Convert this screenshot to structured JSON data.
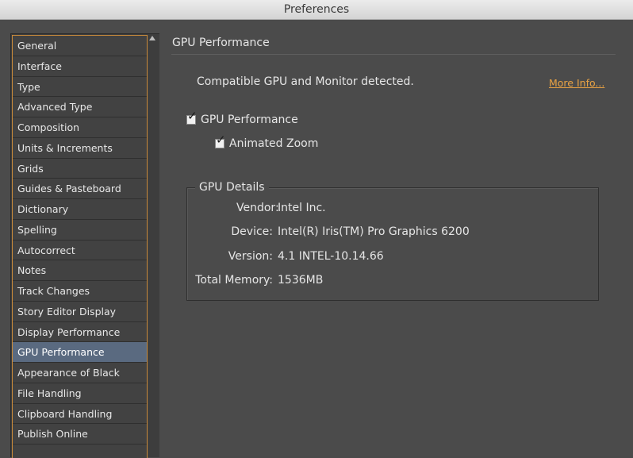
{
  "window": {
    "title": "Preferences"
  },
  "sidebar": {
    "items": [
      {
        "label": "General"
      },
      {
        "label": "Interface"
      },
      {
        "label": "Type"
      },
      {
        "label": "Advanced Type"
      },
      {
        "label": "Composition"
      },
      {
        "label": "Units & Increments"
      },
      {
        "label": "Grids"
      },
      {
        "label": "Guides & Pasteboard"
      },
      {
        "label": "Dictionary"
      },
      {
        "label": "Spelling"
      },
      {
        "label": "Autocorrect"
      },
      {
        "label": "Notes"
      },
      {
        "label": "Track Changes"
      },
      {
        "label": "Story Editor Display"
      },
      {
        "label": "Display Performance"
      },
      {
        "label": "GPU Performance",
        "selected": true
      },
      {
        "label": "Appearance of Black"
      },
      {
        "label": "File Handling"
      },
      {
        "label": "Clipboard Handling"
      },
      {
        "label": "Publish Online"
      }
    ]
  },
  "main": {
    "section_title": "GPU Performance",
    "status_text": "Compatible GPU and Monitor detected.",
    "more_info_link": "More Info...",
    "gpu_performance_checkbox": {
      "label": "GPU Performance",
      "checked": true
    },
    "animated_zoom_checkbox": {
      "label": "Animated Zoom",
      "checked": true
    },
    "details": {
      "legend": "GPU Details",
      "vendor_label": "Vendor:",
      "vendor_value": "Intel Inc.",
      "device_label": "Device:",
      "device_value": "Intel(R) Iris(TM) Pro Graphics 6200",
      "version_label": "Version:",
      "version_value": "4.1 INTEL-10.14.66",
      "memory_label": "Total Memory:",
      "memory_value": "1536MB"
    }
  },
  "colors": {
    "accent_orange": "#e8a244",
    "selection": "#5a6a80",
    "background": "#4b4b4b"
  },
  "icons": {
    "checkmark": "check-icon",
    "scroll_up": "scroll-up-arrow-icon"
  }
}
